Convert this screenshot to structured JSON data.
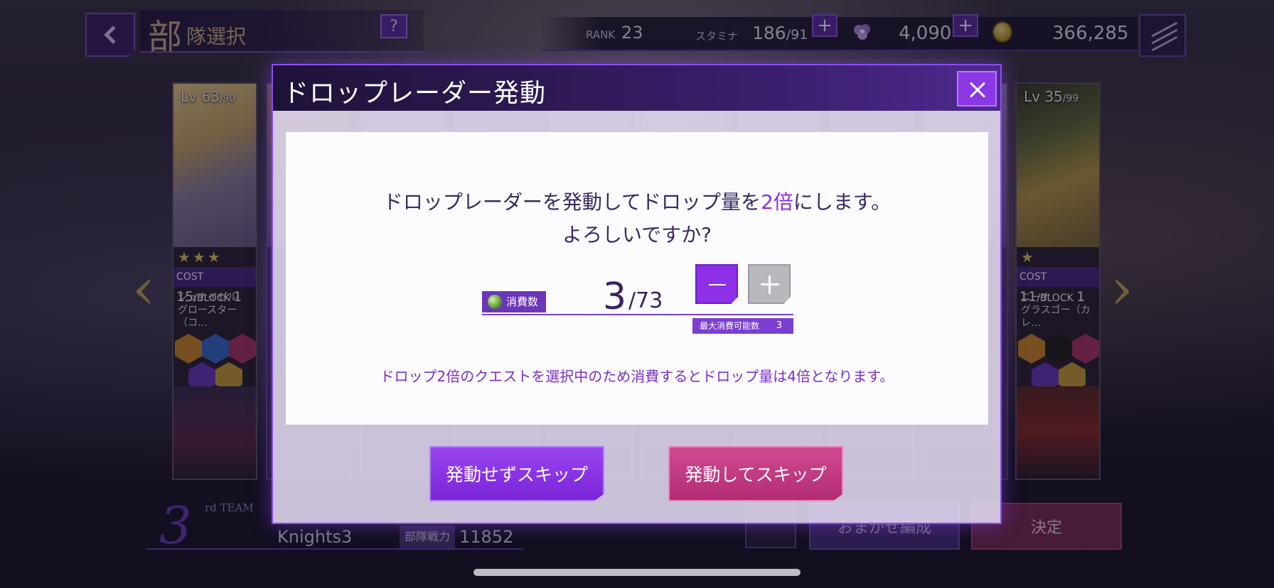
{
  "header": {
    "title_big": "部",
    "title_small": "隊選択",
    "help_label": "?",
    "rank_label": "RANK",
    "rank_value": "23",
    "stamina_label": "スタミナ",
    "stamina_current": "186",
    "stamina_max": "/91",
    "gems": "4,090",
    "coins": "366,285"
  },
  "cards": [
    {
      "lv": "Lv 63",
      "lv_max": "/90",
      "stars": "★★★",
      "cost": "15",
      "block": "1",
      "name_line1": "シュナイゼル",
      "name_line2": "グロースター（コ…"
    },
    {
      "lv": "Lv 35",
      "lv_max": "/99",
      "stars": "★",
      "cost": "11",
      "block": "1",
      "name_line1": "ニーナ",
      "name_line2": "グラスゴー（カレ…"
    }
  ],
  "card_labels": {
    "cost": "COST",
    "block": "/BLOCK"
  },
  "bottom": {
    "team_number": "3",
    "team_suffix": "rd TEAM",
    "team_name": "Knights3",
    "power_label": "部隊戦力",
    "power_value": "11852",
    "auto_label": "おまかせ編成",
    "decide_label": "決定"
  },
  "modal": {
    "title": "ドロップレーダー発動",
    "message_before": "ドロップレーダーを発動してドロップ量を",
    "message_highlight": "2倍",
    "message_after": "にします。",
    "message_line2": "よろしいですか?",
    "qty_label": "消費数",
    "qty_value": "3",
    "qty_max": "/73",
    "max_use_label": "最大消費可能数",
    "max_use_value": "3",
    "note": "ドロップ2倍のクエストを選択中のため消費するとドロップ量は4倍となります。",
    "btn_skip_without": "発動せずスキップ",
    "btn_skip_with": "発動してスキップ"
  },
  "colors": {
    "accent_purple": "#8e30e8",
    "accent_pink": "#c23c84",
    "highlight_text": "#8a2be2"
  },
  "icons": [
    "back-chevron-icon",
    "help-icon",
    "plus-icon",
    "gem-icon",
    "coin-icon",
    "menu-icon",
    "close-icon",
    "orb-icon",
    "minus-icon",
    "refresh-icon"
  ]
}
